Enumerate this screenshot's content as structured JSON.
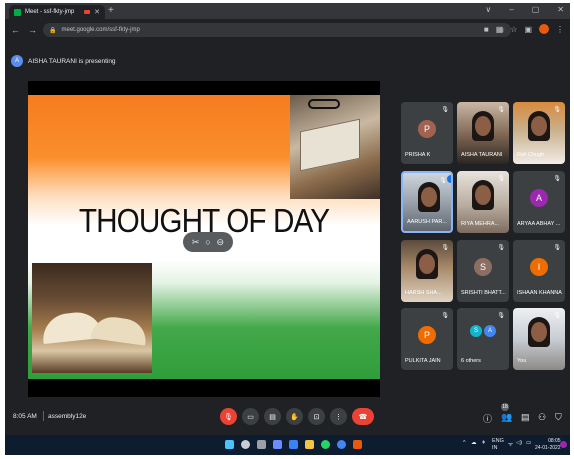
{
  "browser": {
    "tab_title": "Meet - ssf-fkty-jmp",
    "new_tab": "+",
    "url": "meet.google.com/ssf-fkty-jmp",
    "window_controls": [
      "∨",
      "–",
      "▢",
      "✕"
    ]
  },
  "presenting": {
    "avatar_letter": "A",
    "text": "AISHA TAURANI is presenting"
  },
  "slide": {
    "title": "THOUGHT OF DAY"
  },
  "participants": [
    {
      "name": "PRISHA K",
      "letter": "P",
      "color": "#a1634f",
      "type": "avatar"
    },
    {
      "name": "AISHA TAURANI",
      "type": "photo1"
    },
    {
      "name": "Reli Chugh",
      "type": "photo2"
    },
    {
      "name": "AARUSH PAR...",
      "type": "photo3"
    },
    {
      "name": "RIYA MEHRA...",
      "type": "photo4"
    },
    {
      "name": "ARYAA ABHAY ...",
      "letter": "A",
      "color": "#9c27b0",
      "type": "avatar"
    },
    {
      "name": "HARSH SHA...",
      "type": "photo5"
    },
    {
      "name": "SRISHTI BHATT...",
      "letter": "S",
      "color": "#8d6e63",
      "type": "avatar"
    },
    {
      "name": "ISHAAN KHANNA",
      "letter": "I",
      "color": "#ef6c00",
      "type": "avatar"
    },
    {
      "name": "PULKITA JAIN",
      "letter": "P",
      "color": "#ef6c00",
      "type": "avatar"
    },
    {
      "name": "6 others",
      "letters": [
        "S",
        "A"
      ],
      "type": "others"
    },
    {
      "name": "You",
      "type": "photo6"
    }
  ],
  "meeting": {
    "time": "8:05 AM",
    "separator": "|",
    "code": "assembly12e",
    "people_count": "18"
  },
  "taskbar": {
    "lang": "ENG",
    "region": "IN",
    "time": "08:05",
    "date": "24-01-2022"
  },
  "colors": {
    "accent": "#1a73e8",
    "danger": "#ea4335",
    "surface": "#202124",
    "tile": "#3c4043"
  }
}
